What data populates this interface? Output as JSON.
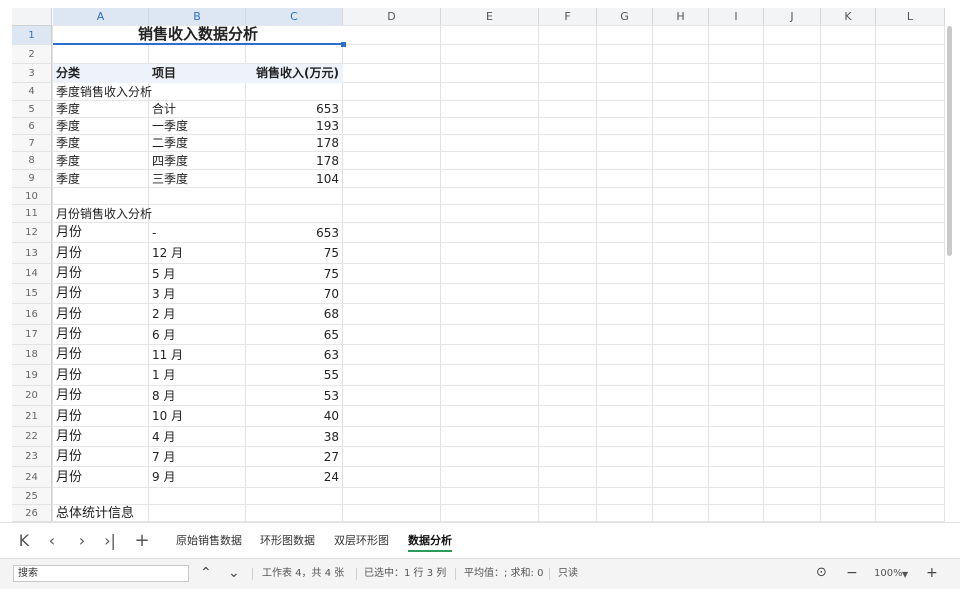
{
  "columns": [
    "A",
    "B",
    "C",
    "D",
    "E",
    "F",
    "G",
    "H",
    "I",
    "J",
    "K",
    "L"
  ],
  "title": "销售收入数据分析",
  "header": {
    "category": "分类",
    "item": "项目",
    "revenue": "销售收入(万元)"
  },
  "section_quarter": "季度销售收入分析",
  "quarter_rows": [
    {
      "cat": "季度",
      "item": "合计",
      "val": "653"
    },
    {
      "cat": "季度",
      "item": "一季度",
      "val": "193"
    },
    {
      "cat": "季度",
      "item": "二季度",
      "val": "178"
    },
    {
      "cat": "季度",
      "item": "四季度",
      "val": "178"
    },
    {
      "cat": "季度",
      "item": "三季度",
      "val": "104"
    }
  ],
  "section_month": "月份销售收入分析",
  "month_rows": [
    {
      "cat": "月份",
      "item": "-",
      "val": "653"
    },
    {
      "cat": "月份",
      "item": "12 月",
      "val": "75"
    },
    {
      "cat": "月份",
      "item": "5 月",
      "val": "75"
    },
    {
      "cat": "月份",
      "item": "3 月",
      "val": "70"
    },
    {
      "cat": "月份",
      "item": "2 月",
      "val": "68"
    },
    {
      "cat": "月份",
      "item": "6 月",
      "val": "65"
    },
    {
      "cat": "月份",
      "item": "11 月",
      "val": "63"
    },
    {
      "cat": "月份",
      "item": "1 月",
      "val": "55"
    },
    {
      "cat": "月份",
      "item": "8 月",
      "val": "53"
    },
    {
      "cat": "月份",
      "item": "10 月",
      "val": "40"
    },
    {
      "cat": "月份",
      "item": "4 月",
      "val": "38"
    },
    {
      "cat": "月份",
      "item": "7 月",
      "val": "27"
    },
    {
      "cat": "月份",
      "item": "9 月",
      "val": "24"
    }
  ],
  "section_total": "总体统计信息",
  "sheet_tabs": [
    "原始销售数据",
    "环形图数据",
    "双层环形图",
    "数据分析"
  ],
  "active_tab": "数据分析",
  "status": {
    "search_placeholder": "搜索",
    "sheet_info": "工作表 4，共 4 张",
    "selection_info": "已选中：1 行 3 列",
    "stats_info": "平均值：; 求和: 0",
    "mode": "只读",
    "zoom": "100%"
  },
  "nav_icons": {
    "first": "⏮",
    "prev": "‹",
    "next": "›",
    "last": "⏭",
    "add": "+"
  },
  "colors": {
    "accent": "#2b6fd0",
    "active_tab_underline": "#2b9a5b"
  }
}
